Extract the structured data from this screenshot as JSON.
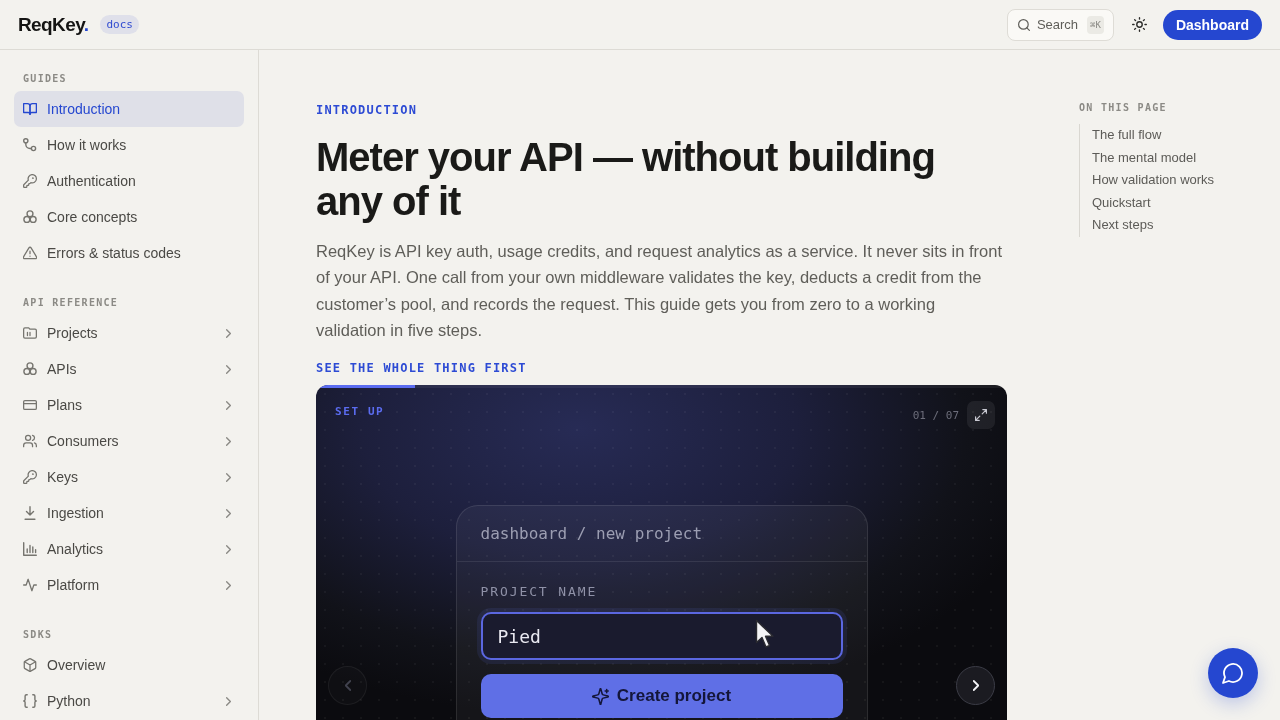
{
  "header": {
    "logo": {
      "name": "ReqKey",
      "dot": "."
    },
    "badge": "docs",
    "search": {
      "label": "Search",
      "shortcut": "⌘K"
    },
    "dashboard_button": "Dashboard"
  },
  "sidebar": {
    "sections": [
      {
        "title": "GUIDES",
        "items": [
          {
            "label": "Introduction",
            "selected": true,
            "expandable": false
          },
          {
            "label": "How it works",
            "selected": false,
            "expandable": false
          },
          {
            "label": "Authentication",
            "selected": false,
            "expandable": false
          },
          {
            "label": "Core concepts",
            "selected": false,
            "expandable": false
          },
          {
            "label": "Errors & status codes",
            "selected": false,
            "expandable": false
          }
        ]
      },
      {
        "title": "API REFERENCE",
        "items": [
          {
            "label": "Projects",
            "selected": false,
            "expandable": true
          },
          {
            "label": "APIs",
            "selected": false,
            "expandable": true
          },
          {
            "label": "Plans",
            "selected": false,
            "expandable": true
          },
          {
            "label": "Consumers",
            "selected": false,
            "expandable": true
          },
          {
            "label": "Keys",
            "selected": false,
            "expandable": true
          },
          {
            "label": "Ingestion",
            "selected": false,
            "expandable": true
          },
          {
            "label": "Analytics",
            "selected": false,
            "expandable": true
          },
          {
            "label": "Platform",
            "selected": false,
            "expandable": true
          }
        ]
      },
      {
        "title": "SDKS",
        "items": [
          {
            "label": "Overview",
            "selected": false,
            "expandable": false
          },
          {
            "label": "Python",
            "selected": false,
            "expandable": true
          }
        ]
      }
    ]
  },
  "article": {
    "eyebrow": "INTRODUCTION",
    "title": "Meter your API — without building any of it",
    "intro": "ReqKey is API key auth, usage credits, and request analytics as a service. It never sits in front of your API. One call from your own middleware validates the key, deducts a credit from the customer’s pool, and records the request. This guide gets you from zero to a working validation in five steps.",
    "demo_heading": "SEE THE WHOLE THING FIRST",
    "demo": {
      "progress": {
        "level": 0.143
      },
      "step_label": "SET UP",
      "counter": "01 / 07",
      "window": {
        "breadcrumb": "dashboard / new project",
        "field_label": "PROJECT NAME",
        "field_value": "Pied",
        "button": "Create project"
      },
      "previous_button": {
        "disabled": true
      },
      "next_button": {
        "disabled": false
      }
    }
  },
  "toc": {
    "title": "ON THIS PAGE",
    "items": [
      "The full flow",
      "The mental model",
      "How validation works",
      "Quickstart",
      "Next steps"
    ]
  }
}
